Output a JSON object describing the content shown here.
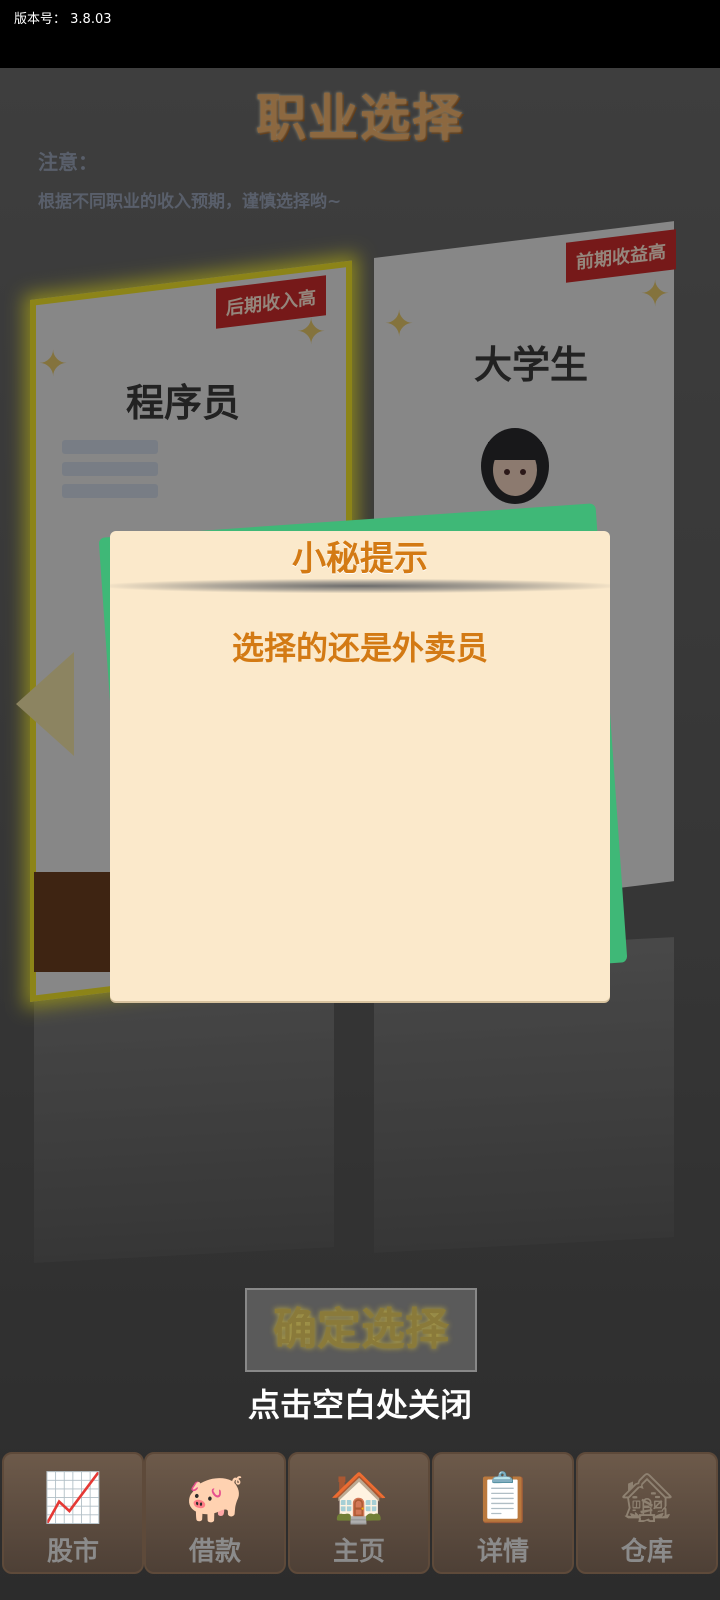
{
  "version": {
    "label": "版本号：",
    "value": "3.8.03"
  },
  "page": {
    "title": "职业选择",
    "note_label": "注意：",
    "note_text": "根据不同职业的收入预期，谨慎选择哟~"
  },
  "careers": [
    {
      "name": "程序员",
      "tag": "后期收入高",
      "selected": true
    },
    {
      "name": "大学生",
      "tag": "前期收益高",
      "selected": false
    }
  ],
  "dialog": {
    "title": "小秘提示",
    "message": "选择的还是外卖员"
  },
  "confirm_label": "确定选择",
  "close_hint": "点击空白处关闭",
  "nav": [
    {
      "label": "股市",
      "icon": "stock-chart-icon"
    },
    {
      "label": "借款",
      "icon": "piggy-bank-icon"
    },
    {
      "label": "主页",
      "icon": "house-icon"
    },
    {
      "label": "详情",
      "icon": "profile-card-icon"
    },
    {
      "label": "仓库",
      "icon": "warehouse-icon"
    }
  ],
  "colors": {
    "title_orange": "#f1b36f",
    "dialog_bg": "#fbe9cb",
    "dialog_text": "#d37a14",
    "ribbon_red": "#cc2b2b",
    "green_back": "#3fb877",
    "selected_glow": "#f1e32a"
  }
}
